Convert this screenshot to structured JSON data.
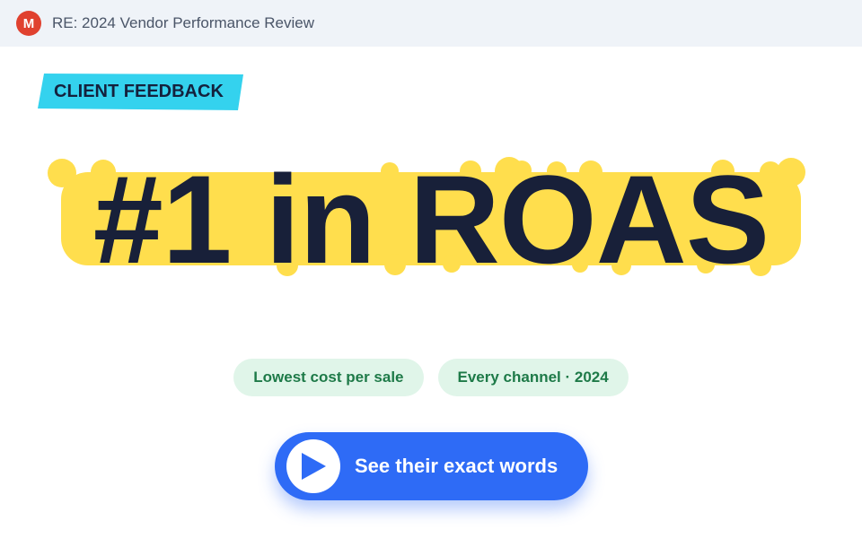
{
  "email": {
    "avatar_letter": "M",
    "subject": "RE: 2024 Vendor Performance Review"
  },
  "tag": {
    "label": "CLIENT FEEDBACK"
  },
  "headline": {
    "text": "#1 in ROAS"
  },
  "pills": [
    {
      "label": "Lowest cost per sale"
    },
    {
      "label": "Every channel · 2024"
    }
  ],
  "cta": {
    "label": "See their exact words",
    "icon": "play-icon"
  },
  "colors": {
    "topbar_bg": "#eff3f8",
    "avatar": "#e0412f",
    "tag_bg": "#34d2ee",
    "highlight": "#ffde4d",
    "headline": "#182039",
    "pill_bg": "#e0f5e9",
    "pill_text": "#1e7a48",
    "cta_bg": "#2e6bf6"
  }
}
